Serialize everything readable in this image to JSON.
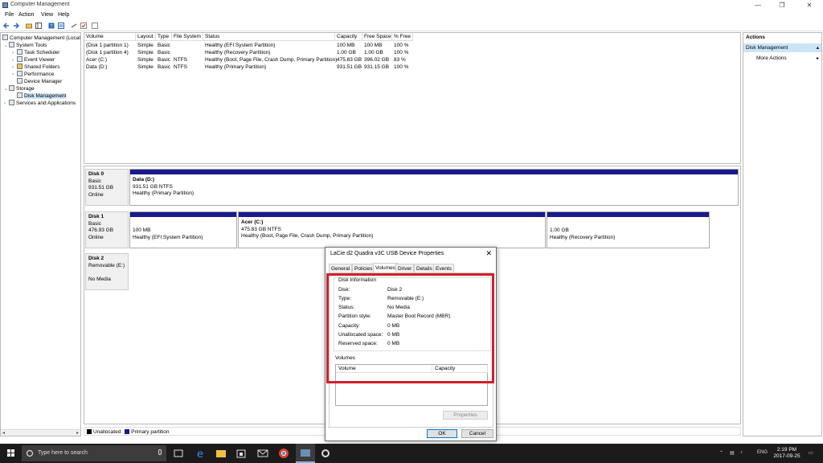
{
  "window": {
    "title": "Computer Management",
    "minimize_glyph": "—",
    "maximize_glyph": "❐",
    "close_glyph": "✕"
  },
  "menu": [
    "File",
    "Action",
    "View",
    "Help"
  ],
  "tree": {
    "root": "Computer Management (Local",
    "system_tools": "System Tools",
    "task_scheduler": "Task Scheduler",
    "event_viewer": "Event Viewer",
    "shared_folders": "Shared Folders",
    "performance": "Performance",
    "device_manager": "Device Manager",
    "storage": "Storage",
    "disk_management": "Disk Management",
    "services": "Services and Applications"
  },
  "volume_table": {
    "headers": [
      "Volume",
      "Layout",
      "Type",
      "File System",
      "Status",
      "Capacity",
      "Free Space",
      "% Free"
    ],
    "rows": [
      [
        "(Disk 1 partition 1)",
        "Simple",
        "Basic",
        "",
        "Healthy (EFI System Partition)",
        "100 MB",
        "100 MB",
        "100 %"
      ],
      [
        "(Disk 1 partition 4)",
        "Simple",
        "Basic",
        "",
        "Healthy (Recovery Partition)",
        "1.00 GB",
        "1.00 GB",
        "100 %"
      ],
      [
        "Acer (C:)",
        "Simple",
        "Basic",
        "NTFS",
        "Healthy (Boot, Page File, Crash Dump, Primary Partition)",
        "475.83 GB",
        "396.02 GB",
        "83 %"
      ],
      [
        "Data (D:)",
        "Simple",
        "Basic",
        "NTFS",
        "Healthy (Primary Partition)",
        "931.51 GB",
        "931.15 GB",
        "100 %"
      ]
    ]
  },
  "disks": {
    "disk0": {
      "name": "Disk 0",
      "type": "Basic",
      "size": "931.51 GB",
      "state": "Online"
    },
    "disk0_part": {
      "name": "Data (D:)",
      "size": "931.51 GB NTFS",
      "status": "Healthy (Primary Partition)"
    },
    "disk1": {
      "name": "Disk 1",
      "type": "Basic",
      "size": "476.93 GB",
      "state": "Online"
    },
    "disk1_p1": {
      "size": "100 MB",
      "status": "Healthy (EFI System Partition)"
    },
    "disk1_p2": {
      "name": "Acer (C:)",
      "size": "475.83 GB NTFS",
      "status": "Healthy (Boot, Page File, Crash Dump, Primary Partition)"
    },
    "disk1_p3": {
      "size": "1.00 GB",
      "status": "Healthy (Recovery Partition)"
    },
    "disk2": {
      "name": "Disk 2",
      "type": "Removable (E:)",
      "state": "No Media"
    }
  },
  "legend": {
    "unallocated": "Unallocated",
    "primary": "Primary partition",
    "unallocated_color": "#000000",
    "primary_color": "#1a1a8a"
  },
  "actions": {
    "header": "Actions",
    "selected": "Disk Management",
    "more": "More Actions"
  },
  "dialog": {
    "title": "LaCie d2 Quadra v3C USB Device Properties",
    "tabs": [
      "General",
      "Policies",
      "Volumes",
      "Driver",
      "Details",
      "Events"
    ],
    "active_tab": "Volumes",
    "info_heading": "Disk Information",
    "info": [
      {
        "k": "Disk:",
        "v": "Disk 2"
      },
      {
        "k": "Type:",
        "v": "Removable (E:)"
      },
      {
        "k": "Status:",
        "v": "No Media"
      },
      {
        "k": "Partition style:",
        "v": "Master Boot Record (MBR)"
      },
      {
        "k": "Capacity:",
        "v": "0 MB"
      },
      {
        "k": "Unallocated space:",
        "v": "0 MB"
      },
      {
        "k": "Reserved space:",
        "v": "0 MB"
      }
    ],
    "volumes_label": "Volumes",
    "vol_headers": [
      "Volume",
      "Capacity"
    ],
    "properties_button": "Properties",
    "ok_button": "OK",
    "cancel_button": "Cancel",
    "highlight_color": "#d0202a"
  },
  "taskbar": {
    "search_placeholder": "Type here to search",
    "lang": "ENG",
    "time": "2:19 PM",
    "date": "2017-09-25"
  }
}
